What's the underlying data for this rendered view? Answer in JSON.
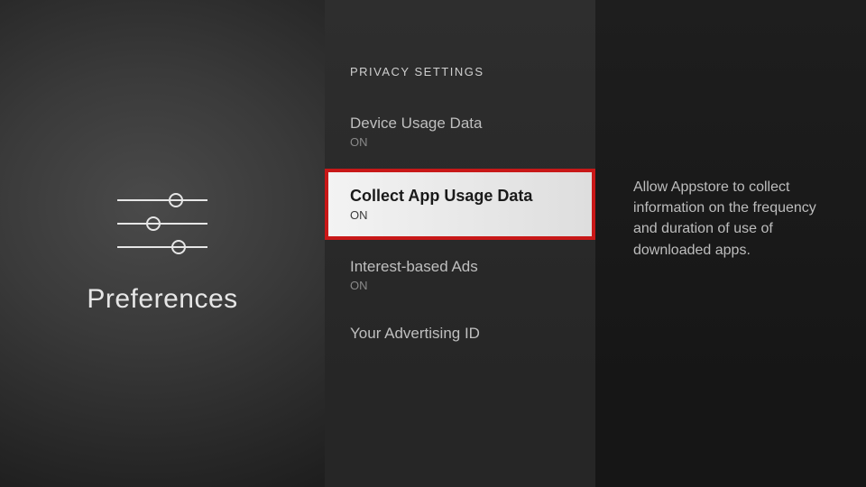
{
  "colors": {
    "highlight_border": "#c81818"
  },
  "left": {
    "title": "Preferences",
    "icon_name": "sliders-icon"
  },
  "list": {
    "section_header": "PRIVACY SETTINGS",
    "items": [
      {
        "label": "Device Usage Data",
        "state": "ON",
        "selected": false
      },
      {
        "label": "Collect App Usage Data",
        "state": "ON",
        "selected": true
      },
      {
        "label": "Interest-based Ads",
        "state": "ON",
        "selected": false
      },
      {
        "label": "Your Advertising ID",
        "state": "",
        "selected": false
      }
    ]
  },
  "detail": {
    "description": "Allow Appstore to collect information on the frequency and duration of use of downloaded apps."
  }
}
